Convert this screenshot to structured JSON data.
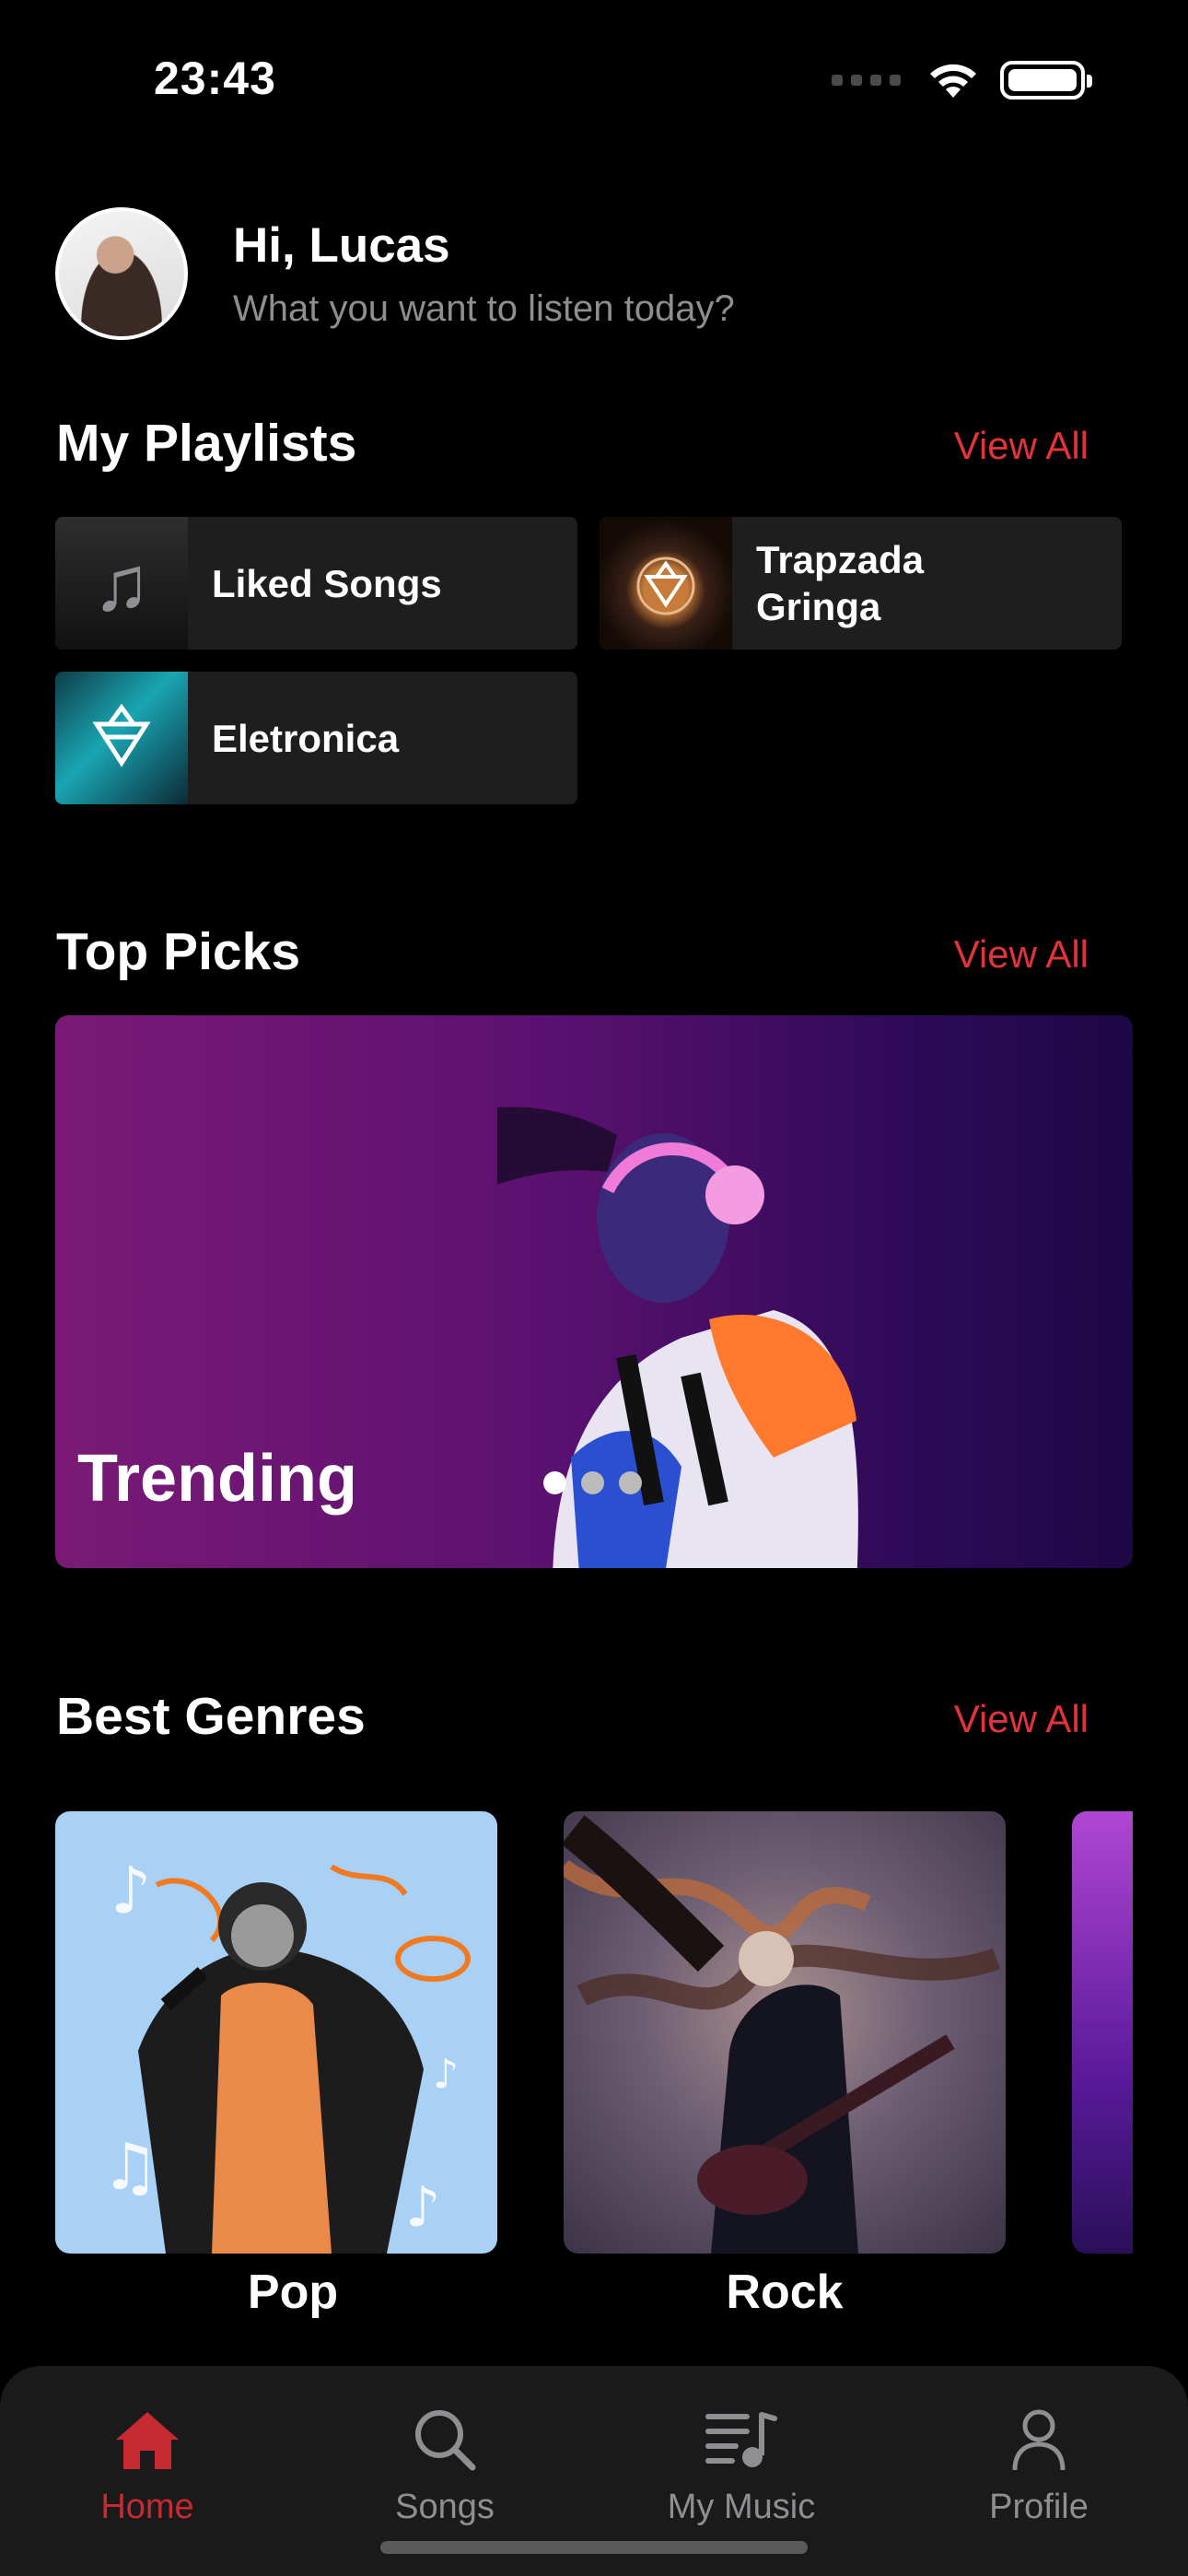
{
  "status_bar": {
    "time": "23:43"
  },
  "header": {
    "greeting": "Hi, Lucas",
    "subtitle": "What you want to listen today?"
  },
  "playlists": {
    "title": "My Playlists",
    "view_all": "View All",
    "items": [
      {
        "label": "Liked Songs",
        "icon": "music-note-icon"
      },
      {
        "label": "Trapzada Gringa",
        "icon": "album-art-ncs"
      },
      {
        "label": "Eletronica",
        "icon": "album-art-ncs"
      }
    ]
  },
  "top_picks": {
    "title": "Top Picks",
    "view_all": "View All",
    "banner_title": "Trending",
    "pages": 3,
    "active_page": 1
  },
  "genres": {
    "title": "Best Genres",
    "view_all": "View All",
    "items": [
      {
        "label": "Pop"
      },
      {
        "label": "Rock"
      }
    ]
  },
  "tab_bar": {
    "tabs": [
      {
        "label": "Home",
        "icon": "home-icon",
        "active": true
      },
      {
        "label": "Songs",
        "icon": "search-icon",
        "active": false
      },
      {
        "label": "My Music",
        "icon": "music-list-icon",
        "active": false
      },
      {
        "label": "Profile",
        "icon": "person-icon",
        "active": false
      }
    ]
  },
  "colors": {
    "accent": "#e0343a",
    "active_tab": "#c62b31",
    "background": "#000000",
    "card": "#1e1e1e"
  }
}
